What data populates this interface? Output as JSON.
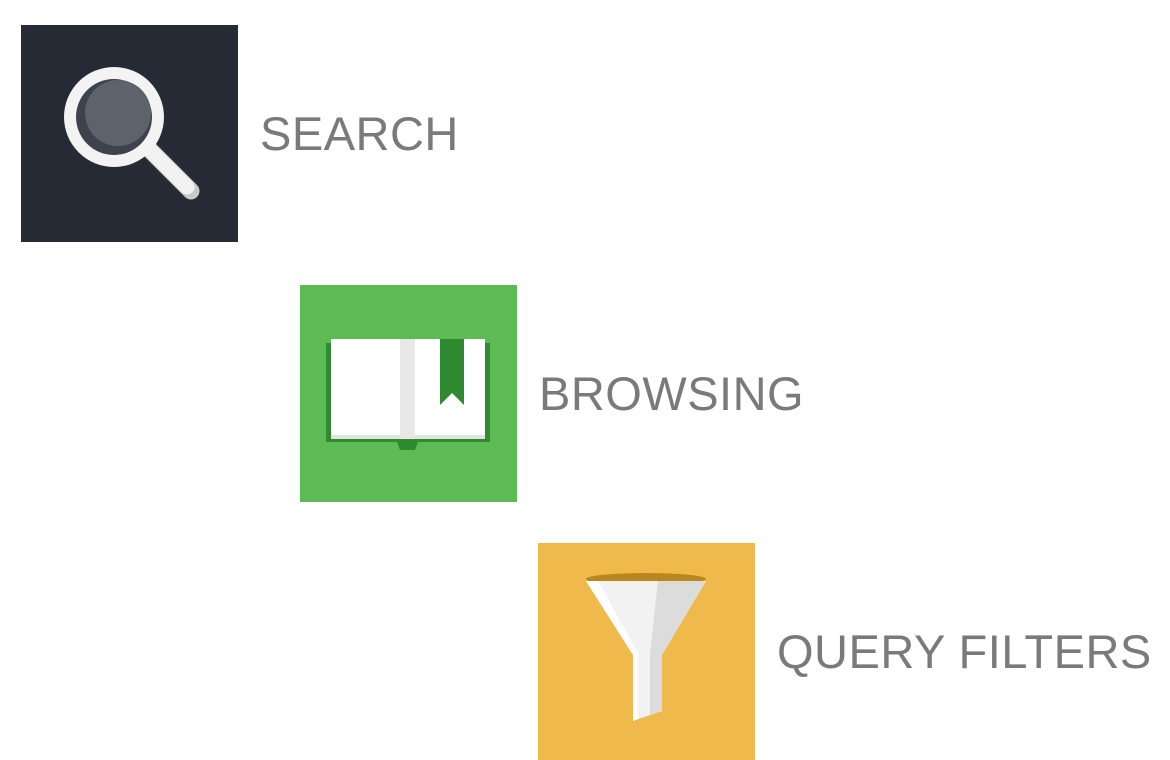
{
  "features": [
    {
      "label": "SEARCH",
      "icon": "magnifier-icon",
      "tile_color": "#252a35"
    },
    {
      "label": "BROWSING",
      "icon": "open-book-icon",
      "tile_color": "#5cbb55"
    },
    {
      "label": "QUERY FILTERS",
      "icon": "funnel-icon",
      "tile_color": "#f0b94b"
    }
  ]
}
